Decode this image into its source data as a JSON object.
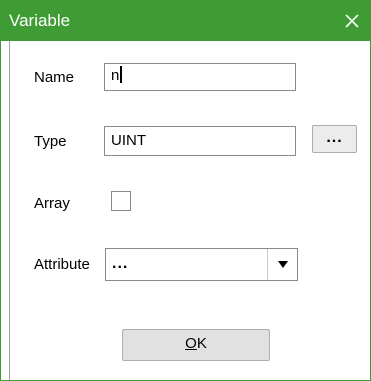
{
  "window": {
    "title": "Variable",
    "accent_color": "#3f9c35",
    "close_icon": "close-icon"
  },
  "form": {
    "name_label": "Name",
    "name_value": "n",
    "type_label": "Type",
    "type_value": "UINT",
    "type_browse_label": "...",
    "array_label": "Array",
    "array_checked": false,
    "attribute_label": "Attribute",
    "attribute_value": "...",
    "attribute_arrow_icon": "dropdown-arrow-icon"
  },
  "buttons": {
    "ok_mnemonic": "O",
    "ok_rest": "K"
  }
}
